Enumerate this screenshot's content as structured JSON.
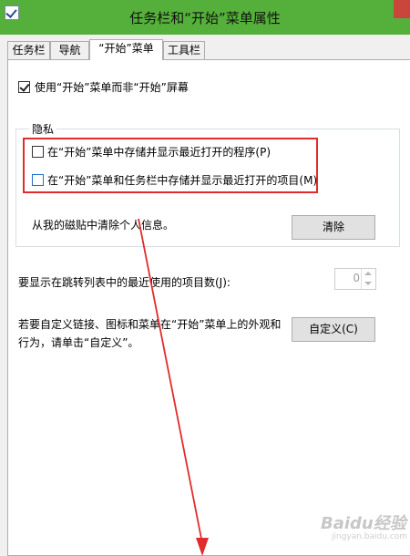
{
  "window": {
    "title": "任务栏和“开始”菜单属性",
    "icon": "taskbar-properties-icon"
  },
  "tabs": [
    {
      "label": "任务栏",
      "active": false
    },
    {
      "label": "导航",
      "active": false
    },
    {
      "label": "“开始”菜单",
      "active": true
    },
    {
      "label": "工具栏",
      "active": false
    }
  ],
  "start_menu": {
    "use_start_menu_label": "使用“开始”菜单而非“开始”屏幕",
    "use_start_menu_checked": true
  },
  "privacy": {
    "group_title": "隐私",
    "store_programs_label": "在“开始”菜单中存储并显示最近打开的程序(P)",
    "store_programs_checked": false,
    "store_items_label": "在“开始”菜单和任务栏中存储并显示最近打开的项目(M)",
    "store_items_checked": false,
    "clear_text": "从我的磁贴中清除个人信息。",
    "clear_button": "清除"
  },
  "jump_list": {
    "label": "要显示在跳转列表中的最近使用的项目数(J):",
    "value": "0"
  },
  "customize": {
    "text_line1": "若要自定义链接、图标和菜单在“开始”菜单上的外观和",
    "text_line2": "行为，请单击“自定义”。",
    "button": "自定义(C)"
  },
  "watermark": {
    "brand": "Baidu经验",
    "sub": "jingyan.baidu.com"
  },
  "colors": {
    "titlebar": "#55b03b",
    "highlight": "#e22b2b",
    "arrow": "#e22b2b"
  }
}
